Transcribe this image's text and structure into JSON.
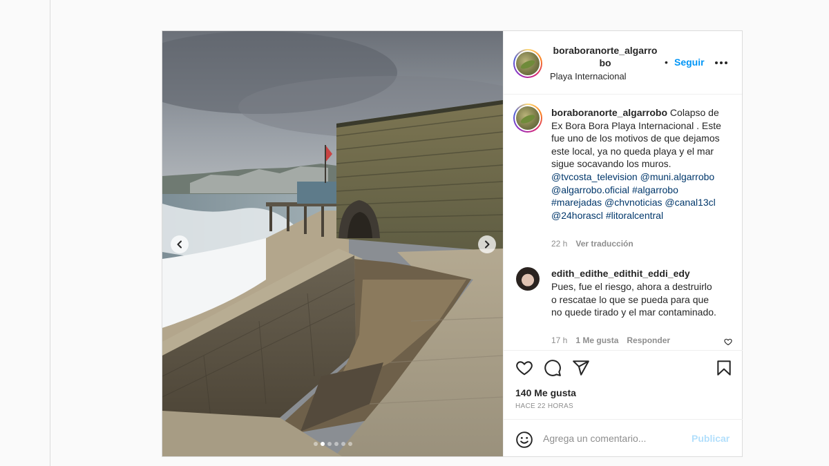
{
  "post": {
    "username": "boraboranorte_algarrobo",
    "username_line1": "boraboranorte_algarro",
    "username_line2": "bo",
    "location": "Playa Internacional",
    "separator": "•",
    "follow_label": "Seguir",
    "more_icon": "more-horizontal-icon"
  },
  "caption": {
    "username": "boraboranorte_algarrobo",
    "text": "Colapso de Ex Bora Bora Playa Internacional . Este fue uno de los motivos de que dejamos este local, ya no queda playa y el mar sigue socavando los muros.",
    "tags": [
      "@tvcosta_television",
      "@muni.algarrobo",
      "@algarrobo.oficial",
      "#algarrobo",
      "#marejadas",
      "@chvnoticias",
      "@canal13cl",
      "@24horascl",
      "#litoralcentral"
    ],
    "time": "22 h",
    "translate_label": "Ver traducción"
  },
  "comment": {
    "username": "edith_edithe_edithit_eddi_edy",
    "text": "Pues, fue el riesgo, ahora a destruirlo o rescatae lo que se pueda para que no quede tirado y el mar contaminado.",
    "time": "17 h",
    "likes_label": "1 Me gusta",
    "reply_label": "Responder"
  },
  "actions": {
    "icons": [
      "heart-icon",
      "comment-icon",
      "share-icon",
      "bookmark-icon"
    ]
  },
  "likes": "140 Me gusta",
  "timestamp": "HACE 22 HORAS",
  "add_comment": {
    "placeholder": "Agrega un comentario...",
    "publish_label": "Publicar"
  },
  "carousel": {
    "total": 6,
    "active": 2
  },
  "colors": {
    "accent": "#0095f6",
    "tag": "#00376b",
    "muted": "#8e8e8e",
    "publish_disabled": "#b2dffc"
  }
}
